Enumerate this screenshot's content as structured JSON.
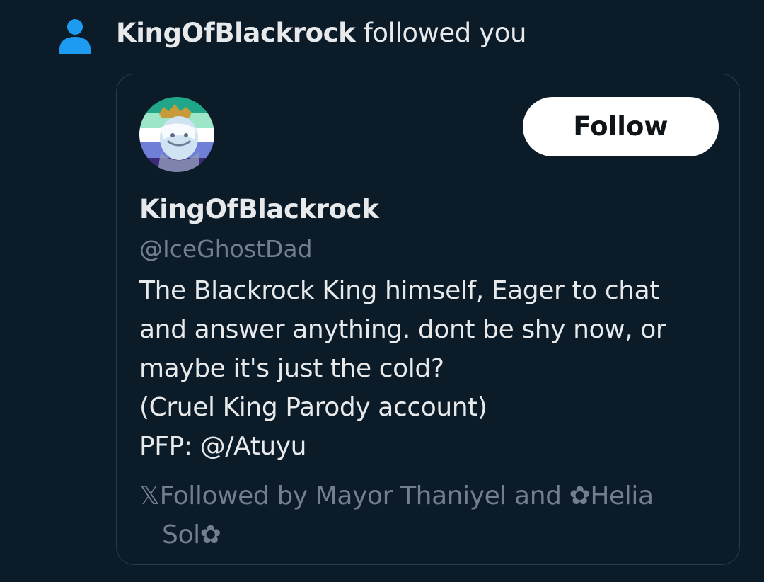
{
  "notification": {
    "icon": "person-icon",
    "accent_color": "#1d9bf0",
    "actor": "KingOfBlackrock",
    "action": "followed you"
  },
  "profile_card": {
    "avatar": "profile-avatar",
    "follow_label": "Follow",
    "display_name": "KingOfBlackrock",
    "handle": "@IceGhostDad",
    "bio_lines": [
      "The Blackrock King himself, Eager to chat",
      "and answer anything. dont be shy now, or",
      "maybe it's just the cold?",
      "(Cruel King Parody account)",
      "PFP: @/Atuyu"
    ],
    "followed_by_lines": [
      "𝕏Followed by Mayor Thaniyel and ✿Helia",
      "Sol✿"
    ]
  }
}
